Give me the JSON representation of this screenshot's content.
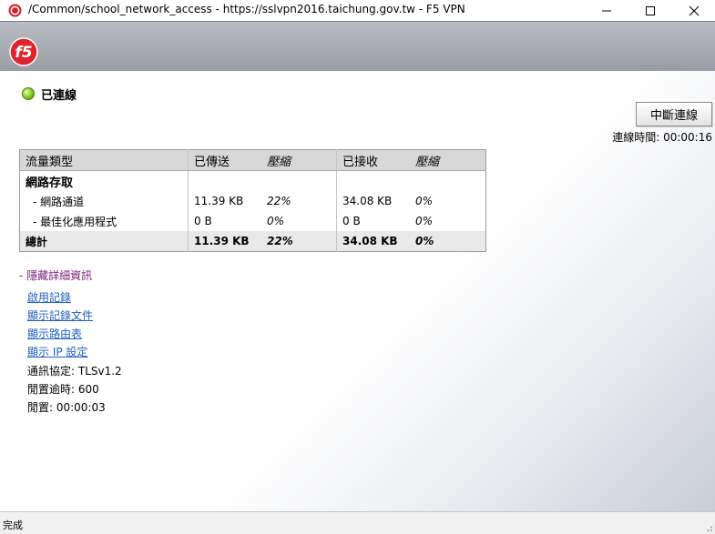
{
  "window": {
    "title": "/Common/school_network_access - https://sslvpn2016.taichung.gov.tw - F5 VPN",
    "app_icon": "f5-app-icon",
    "controls": [
      "minimize-icon",
      "maximize-icon",
      "close-icon"
    ]
  },
  "header": {
    "logo": "f5"
  },
  "status": {
    "text": "已連線",
    "indicator_color": "#8ed12a"
  },
  "disconnect_label": "中斷連線",
  "connection_time": {
    "label": "連線時間:",
    "value": "00:00:16"
  },
  "traffic": {
    "headers": [
      "流量類型",
      "已傳送",
      "壓縮",
      "已接收",
      "壓縮"
    ],
    "section": "網路存取",
    "rows": [
      {
        "name": "- 網路通道",
        "sent": "11.39 KB",
        "sent_comp": "22%",
        "recv": "34.08 KB",
        "recv_comp": "0%"
      },
      {
        "name": "- 最佳化應用程式",
        "sent": "0 B",
        "sent_comp": "0%",
        "recv": "0 B",
        "recv_comp": "0%"
      }
    ],
    "total": {
      "name": "總計",
      "sent": "11.39 KB",
      "sent_comp": "22%",
      "recv": "34.08 KB",
      "recv_comp": "0%"
    }
  },
  "hide_details": "- 隱藏詳細資訊",
  "links": [
    "啟用記錄",
    "顯示記錄文件",
    "顯示路由表",
    "顯示 IP 設定"
  ],
  "info": {
    "protocol": "通訊協定: TLSv1.2",
    "idle_timeout": "閒置逾時: 600",
    "idle": "閒置: 00:00:03"
  },
  "statusbar": {
    "text": "完成"
  }
}
